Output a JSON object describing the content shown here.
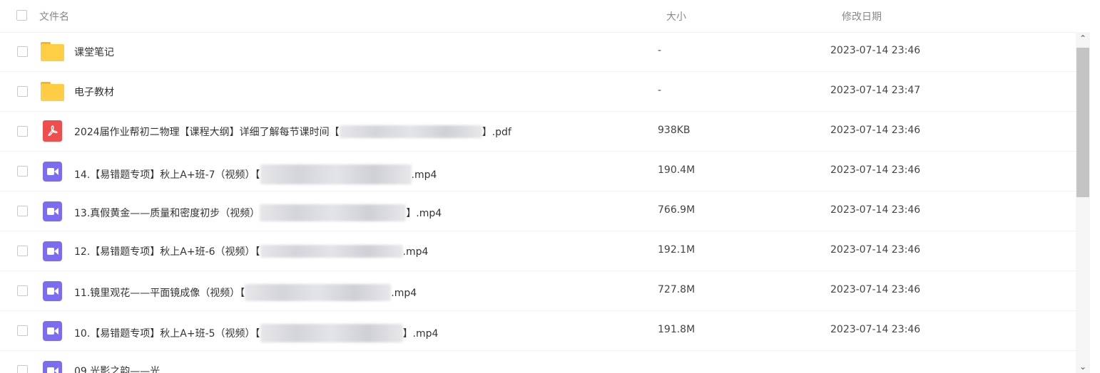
{
  "header": {
    "name_label": "文件名",
    "size_label": "大小",
    "date_label": "修改日期"
  },
  "files": [
    {
      "type": "folder",
      "name": "课堂笔记",
      "size": "-",
      "date": "2023-07-14 23:46"
    },
    {
      "type": "folder",
      "name": "电子教材",
      "size": "-",
      "date": "2023-07-14 23:47"
    },
    {
      "type": "pdf",
      "name_prefix": "2024届作业帮初二物理【课程大纲】详细了解每节课时间【",
      "name_suffix": "】.pdf",
      "size": "938KB",
      "date": "2023-07-14 23:46"
    },
    {
      "type": "video",
      "name_prefix": "14.【易错题专项】秋上A+班-7（视频）【",
      "name_suffix": ".mp4",
      "size": "190.4M",
      "date": "2023-07-14 23:46"
    },
    {
      "type": "video",
      "name_prefix": "13.真假黄金——质量和密度初步（视频）",
      "name_suffix": "】.mp4",
      "size": "766.9M",
      "date": "2023-07-14 23:46"
    },
    {
      "type": "video",
      "name_prefix": "12.【易错题专项】秋上A+班-6（视频）【",
      "name_suffix": ".mp4",
      "size": "192.1M",
      "date": "2023-07-14 23:46"
    },
    {
      "type": "video",
      "name_prefix": "11.镜里观花——平面镜成像（视频）【",
      "name_suffix": ".mp4",
      "size": "727.8M",
      "date": "2023-07-14 23:46"
    },
    {
      "type": "video",
      "name_prefix": "10.【易错题专项】秋上A+班-5（视频）【",
      "name_suffix": "】.mp4",
      "size": "191.8M",
      "date": "2023-07-14 23:46"
    },
    {
      "type": "video",
      "name_prefix": "09.光影之韵——光",
      "name_suffix": "",
      "size": "",
      "date": ""
    }
  ],
  "scrollbar": {
    "up_arrow": "⌃",
    "down_arrow": "⌄"
  }
}
